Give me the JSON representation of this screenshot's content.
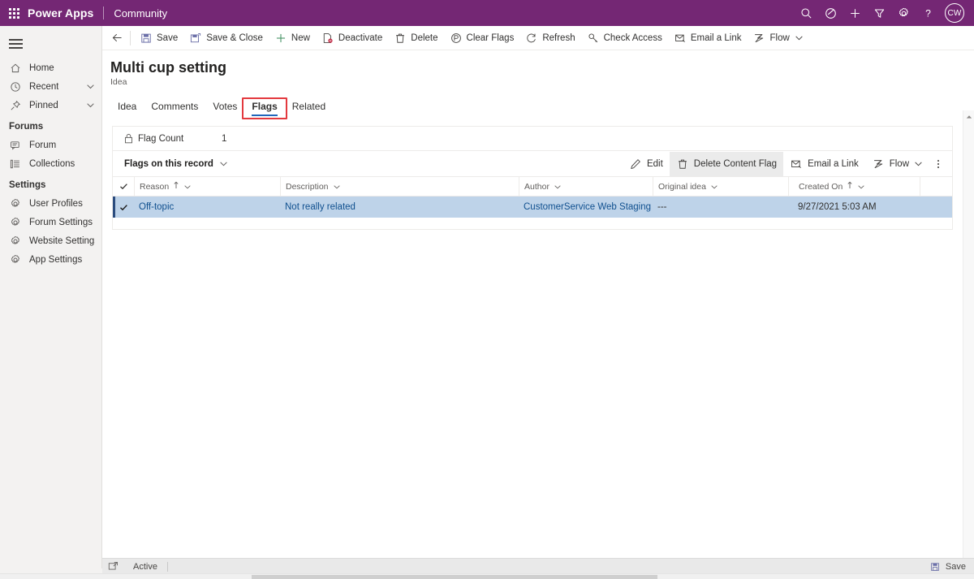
{
  "topbar": {
    "waffle_label": "App launcher",
    "brand": "Power Apps",
    "environment": "Community",
    "icons": [
      {
        "name": "search-icon",
        "label": "Search"
      },
      {
        "name": "assistant-icon",
        "label": "Assistant"
      },
      {
        "name": "plus-icon",
        "label": "Quick create"
      },
      {
        "name": "filter-icon",
        "label": "Filter"
      },
      {
        "name": "gear-icon",
        "label": "Settings"
      },
      {
        "name": "help-icon",
        "label": "Help"
      }
    ],
    "avatar_initials": "CW"
  },
  "sidebar": {
    "hamburger_label": "Expand navigation",
    "items": [
      {
        "label": "Home",
        "icon": "home-icon",
        "chevron": false
      },
      {
        "label": "Recent",
        "icon": "clock-icon",
        "chevron": true
      },
      {
        "label": "Pinned",
        "icon": "pin-icon",
        "chevron": true
      }
    ],
    "groups": [
      {
        "title": "Forums",
        "items": [
          {
            "label": "Forum",
            "icon": "forum-icon"
          },
          {
            "label": "Collections",
            "icon": "collections-icon"
          }
        ]
      },
      {
        "title": "Settings",
        "items": [
          {
            "label": "User Profiles",
            "icon": "gear-icon"
          },
          {
            "label": "Forum Settings",
            "icon": "gear-icon"
          },
          {
            "label": "Website Settings",
            "icon": "gear-icon"
          },
          {
            "label": "App Settings",
            "icon": "gear-icon"
          }
        ]
      }
    ]
  },
  "command_bar": {
    "back_label": "Back",
    "buttons": [
      {
        "label": "Save",
        "icon": "save-icon",
        "chevron": false
      },
      {
        "label": "Save & Close",
        "icon": "save-close-icon",
        "chevron": false
      },
      {
        "label": "New",
        "icon": "plus-icon",
        "chevron": false
      },
      {
        "label": "Deactivate",
        "icon": "deactivate-icon",
        "chevron": false
      },
      {
        "label": "Delete",
        "icon": "trash-icon",
        "chevron": false
      },
      {
        "label": "Clear Flags",
        "icon": "clear-flags-icon",
        "chevron": false
      },
      {
        "label": "Refresh",
        "icon": "refresh-icon",
        "chevron": false
      },
      {
        "label": "Check Access",
        "icon": "key-icon",
        "chevron": false
      },
      {
        "label": "Email a Link",
        "icon": "email-link-icon",
        "chevron": false
      },
      {
        "label": "Flow",
        "icon": "flow-icon",
        "chevron": true
      }
    ]
  },
  "record": {
    "title": "Multi cup setting",
    "entity": "Idea",
    "tabs": [
      {
        "label": "Idea",
        "selected": false,
        "highlighted": false
      },
      {
        "label": "Comments",
        "selected": false,
        "highlighted": false
      },
      {
        "label": "Votes",
        "selected": false,
        "highlighted": false
      },
      {
        "label": "Flags",
        "selected": true,
        "highlighted": true
      },
      {
        "label": "Related",
        "selected": false,
        "highlighted": false
      }
    ],
    "highlight_color": "#e3393e"
  },
  "form": {
    "flag_count_label": "Flag Count",
    "flag_count_value": "1",
    "flag_count_locked": true
  },
  "subgrid": {
    "title": "Flags on this record",
    "commands": [
      {
        "label": "Edit",
        "icon": "pencil-icon",
        "active": false,
        "chevron": false
      },
      {
        "label": "Delete Content Flag",
        "icon": "trash-icon",
        "active": true,
        "chevron": false
      },
      {
        "label": "Email a Link",
        "icon": "email-link-icon",
        "active": false,
        "chevron": false
      },
      {
        "label": "Flow",
        "icon": "flow-icon",
        "active": false,
        "chevron": true
      }
    ],
    "overflow_label": "More commands",
    "columns": [
      {
        "label": "Reason",
        "sorted": true,
        "sort_dir": "asc"
      },
      {
        "label": "Description",
        "sorted": false,
        "sort_dir": ""
      },
      {
        "label": "Author",
        "sorted": false,
        "sort_dir": ""
      },
      {
        "label": "Original idea",
        "sorted": false,
        "sort_dir": ""
      },
      {
        "label": "Created On",
        "sorted": true,
        "sort_dir": "asc"
      }
    ],
    "rows": [
      {
        "selected": true,
        "reason": "Off-topic",
        "description": "Not really related",
        "author": "CustomerService Web Staging",
        "original_idea": "---",
        "created_on": "9/27/2021 5:03 AM"
      }
    ],
    "selected_row_color": "#bed3e9"
  },
  "status_bar": {
    "state_label": "Active",
    "save_label": "Save",
    "save_icon": "save-icon",
    "state_icon": "popout-icon"
  }
}
